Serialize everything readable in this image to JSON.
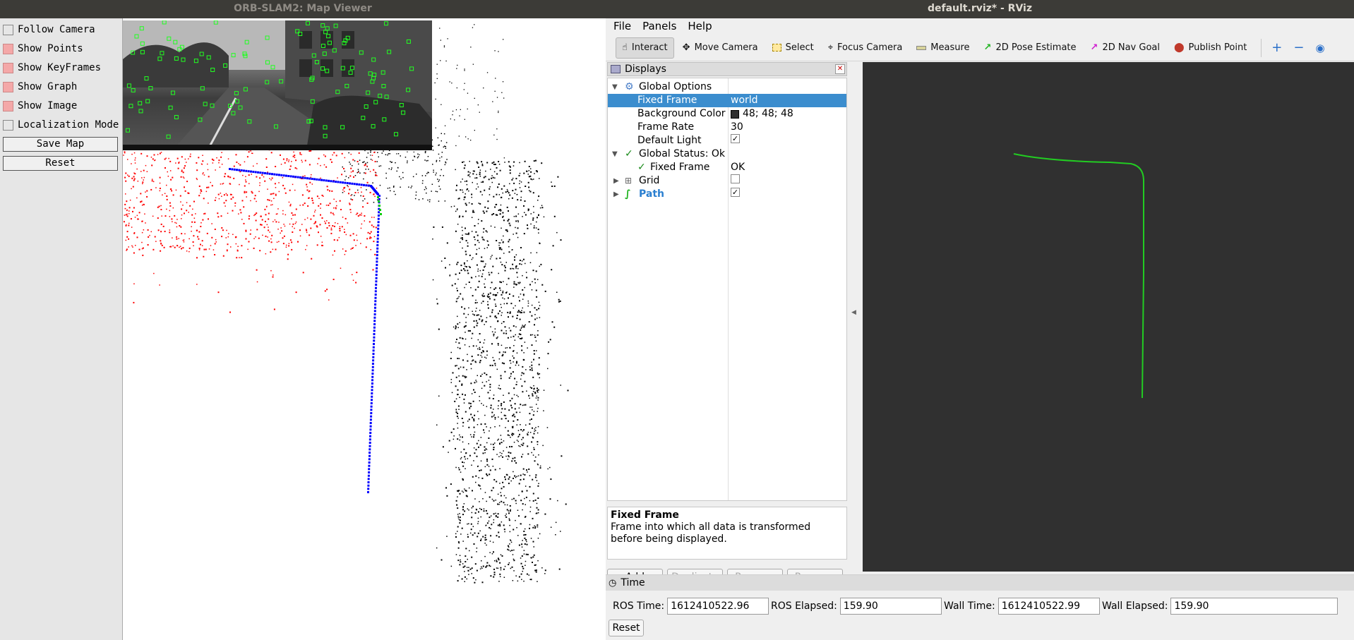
{
  "orb_window": {
    "title": "ORB-SLAM2: Map Viewer",
    "panel": {
      "checkboxes": [
        {
          "label": "Follow Camera",
          "checked": false
        },
        {
          "label": "Show Points",
          "checked": true
        },
        {
          "label": "Show KeyFrames",
          "checked": true
        },
        {
          "label": "Show Graph",
          "checked": true
        },
        {
          "label": "Show Image",
          "checked": true
        },
        {
          "label": "Localization Mode",
          "checked": false
        }
      ],
      "save_map": "Save Map",
      "reset": "Reset"
    },
    "colors": {
      "current_map_points": "#ff0000",
      "map_points": "#000000",
      "keyframes": "#0000ff",
      "current_keyframe": "#00cc00"
    }
  },
  "rviz_window": {
    "title": "default.rviz* - RViz",
    "menu": [
      "File",
      "Panels",
      "Help"
    ],
    "toolbar": [
      {
        "label": "Interact",
        "icon": "cursor-hand-icon",
        "active": true
      },
      {
        "label": "Move Camera",
        "icon": "move-camera-icon"
      },
      {
        "label": "Select",
        "icon": "select-box-icon"
      },
      {
        "label": "Focus Camera",
        "icon": "focus-camera-icon"
      },
      {
        "label": "Measure",
        "icon": "measure-ruler-icon"
      },
      {
        "label": "2D Pose Estimate",
        "icon": "pose-arrow-green-icon"
      },
      {
        "label": "2D Nav Goal",
        "icon": "nav-goal-arrow-magenta-icon"
      },
      {
        "label": "Publish Point",
        "icon": "map-pin-icon"
      }
    ],
    "displays": {
      "header": "Displays",
      "tree": [
        {
          "label": "Global Options",
          "value": ""
        },
        {
          "label": "Fixed Frame",
          "value": "world"
        },
        {
          "label": "Background Color",
          "value": "48; 48; 48"
        },
        {
          "label": "Frame Rate",
          "value": "30"
        },
        {
          "label": "Default Light",
          "value": ""
        },
        {
          "label": "Global Status: Ok",
          "value": ""
        },
        {
          "label": "Fixed Frame",
          "value": "OK"
        },
        {
          "label": "Grid",
          "value": ""
        },
        {
          "label": "Path",
          "value": ""
        }
      ],
      "description_title": "Fixed Frame",
      "description_text": "Frame into which all data is transformed before being displayed.",
      "buttons": [
        "Add",
        "Duplicate",
        "Remove",
        "Rename"
      ]
    },
    "view": {
      "background": "#303030",
      "path_color": "#22cc22"
    },
    "time": {
      "header": "Time",
      "ros_time_label": "ROS Time:",
      "ros_time": "1612410522.96",
      "ros_elapsed_label": "ROS Elapsed:",
      "ros_elapsed": "159.90",
      "wall_time_label": "Wall Time:",
      "wall_time": "1612410522.99",
      "wall_elapsed_label": "Wall Elapsed:",
      "wall_elapsed": "159.90",
      "reset": "Reset"
    }
  }
}
